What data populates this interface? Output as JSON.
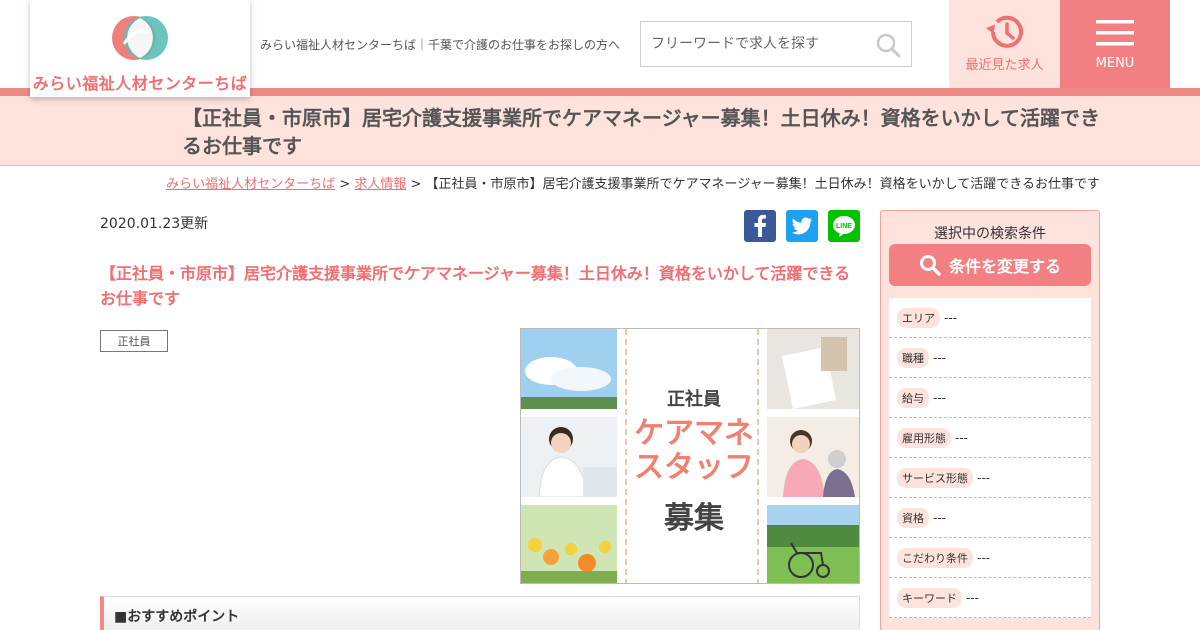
{
  "header": {
    "logo_text": "みらい福祉人材センターちば",
    "tagline": "みらい福祉人材センターちば｜千葉で介護のお仕事をお探しの方へ",
    "search_placeholder": "フリーワードで求人を探す",
    "recent_label": "最近見た求人",
    "menu_label": "MENU"
  },
  "page": {
    "title": "【正社員・市原市】居宅介護支援事業所でケアマネージャー募集！土日休み！資格をいかして活躍できるお仕事です"
  },
  "breadcrumb": {
    "home": "みらい福祉人材センターちば",
    "sep1": " > ",
    "jobs": "求人情報",
    "sep2": " > ",
    "current": "【正社員・市原市】居宅介護支援事業所でケアマネージャー募集！土日休み！資格をいかして活躍できるお仕事です"
  },
  "job": {
    "updated": "2020.01.23更新",
    "title": "【正社員・市原市】居宅介護支援事業所でケアマネージャー募集！土日休み！資格をいかして活躍できるお仕事です",
    "employment_tag": "正社員",
    "image_text": {
      "line1": "正社員",
      "line2": "ケアマネ",
      "line3": "スタッフ",
      "line4": "募集"
    },
    "section_heading": "■おすすめポイント"
  },
  "social": {
    "facebook": "facebook-icon",
    "twitter": "twitter-icon",
    "line_label": "LINE",
    "colors": {
      "facebook": "#3b5998",
      "twitter": "#1da1f2",
      "line": "#00c300"
    }
  },
  "sidebar": {
    "heading": "選択中の検索条件",
    "change_button": "条件を変更する",
    "conditions": [
      {
        "label": "エリア",
        "value": "---"
      },
      {
        "label": "職種",
        "value": "---"
      },
      {
        "label": "給与",
        "value": "---"
      },
      {
        "label": "雇用形態",
        "value": "---"
      },
      {
        "label": "サービス形態",
        "value": "---"
      },
      {
        "label": "資格",
        "value": "---"
      },
      {
        "label": "こだわり条件",
        "value": "---"
      },
      {
        "label": "キーワード",
        "value": "---"
      }
    ]
  },
  "colors": {
    "accent": "#f27f81",
    "accent_light": "#fde3dc",
    "title_pink": "#ef6f73"
  }
}
